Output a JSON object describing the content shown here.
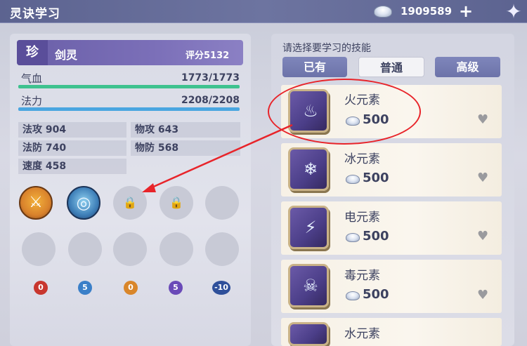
{
  "header": {
    "title": "灵诀学习",
    "currency_icon": "silver-ingot-icon",
    "currency_amount": "1909589",
    "add_label": "+",
    "corner_icon": "star-emblem-icon"
  },
  "character": {
    "rarity": "珍",
    "name": "剑灵",
    "rating_label": "评分",
    "rating_value": "5132",
    "hp_label": "气血",
    "hp_value": "1773/1773",
    "mp_label": "法力",
    "mp_value": "2208/2208",
    "colors": {
      "hp": "#3ec28f",
      "mp": "#4aa6e0"
    }
  },
  "attributes": [
    {
      "label": "法攻",
      "value": "904"
    },
    {
      "label": "物攻",
      "value": "643"
    },
    {
      "label": "法防",
      "value": "740"
    },
    {
      "label": "物防",
      "value": "568"
    },
    {
      "label": "速度",
      "value": "458"
    }
  ],
  "skill_slots": [
    {
      "state": "learned",
      "icon": "golden-swords-icon"
    },
    {
      "state": "learned",
      "icon": "blue-swirl-icon"
    },
    {
      "state": "locked",
      "icon": "lock-icon"
    },
    {
      "state": "locked",
      "icon": "lock-icon"
    },
    {
      "state": "empty"
    },
    {
      "state": "empty"
    },
    {
      "state": "empty"
    },
    {
      "state": "empty"
    },
    {
      "state": "empty"
    },
    {
      "state": "empty"
    }
  ],
  "elements": [
    {
      "value": "0",
      "color": "#c8362e",
      "icon": "fire-drop-icon"
    },
    {
      "value": "5",
      "color": "#3a7fc8",
      "icon": "water-drop-icon"
    },
    {
      "value": "0",
      "color": "#d9862a",
      "icon": "earth-drop-icon"
    },
    {
      "value": "5",
      "color": "#6a4ab8",
      "icon": "poison-drop-icon"
    },
    {
      "value": "-10",
      "color": "#2e4f9a",
      "icon": "wind-drop-icon"
    }
  ],
  "learn_panel": {
    "prompt": "请选择要学习的技能",
    "tabs": [
      "已有",
      "普通",
      "高级"
    ],
    "active_tab": "普通"
  },
  "skills": [
    {
      "name": "火元素",
      "price": "500",
      "icon": "fire-element-icon"
    },
    {
      "name": "冰元素",
      "price": "500",
      "icon": "ice-element-icon"
    },
    {
      "name": "电元素",
      "price": "500",
      "icon": "lightning-element-icon"
    },
    {
      "name": "毒元素",
      "price": "500",
      "icon": "poison-element-icon"
    },
    {
      "name": "水元素",
      "price": "",
      "icon": "water-element-icon"
    }
  ],
  "annotation": {
    "color": "#e8242a"
  }
}
